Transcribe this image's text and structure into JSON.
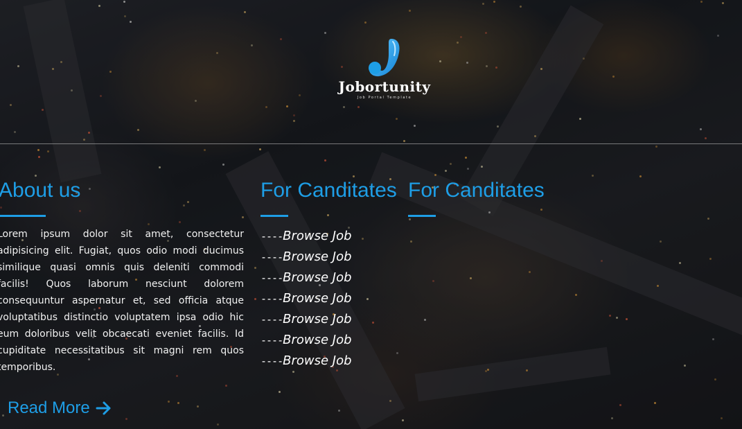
{
  "brand": {
    "name": "Jobortunity",
    "tagline": "Job Portal Template",
    "accent_color": "#1e9ee6",
    "logo_icon": "logo-j-drop-icon"
  },
  "about": {
    "title": "About us",
    "text": "Lorem ipsum dolor sit amet, consectetur adipisicing elit. Fugiat, quos odio modi ducimus similique quasi omnis quis deleniti commodi facilis! Quos laborum nesciunt dolorem consequuntur aspernatur et, sed officia atque voluptatibus distinctio voluptatem ipsa odio hic eum doloribus velit obcaecati eveniet facilis. Id cupiditate necessitatibus sit magni rem quos temporibus.",
    "read_more_label": "Read More",
    "read_more_icon": "arrow-right-icon"
  },
  "candidates": {
    "title": "For Canditates",
    "prefix": "----",
    "links": [
      "Browse Job",
      "Browse Job",
      "Browse Job",
      "Browse Job",
      "Browse Job",
      "Browse Job",
      "Browse Job"
    ]
  },
  "candidates_2": {
    "title": "For Canditates"
  },
  "background": {
    "description_icon": "night-city-background",
    "overlay_color": "#000000"
  }
}
